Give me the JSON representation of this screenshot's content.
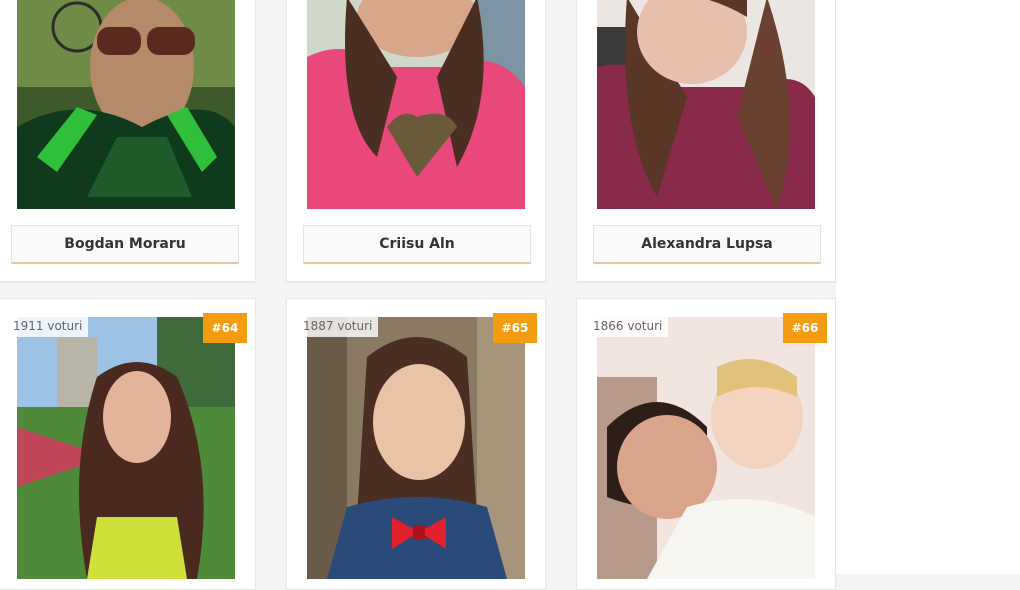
{
  "colors": {
    "accent": "#f39c12",
    "name_underline": "#e2c99a"
  },
  "row1": [
    {
      "name": "Bogdan Moraru"
    },
    {
      "name": "Criisu Aln"
    },
    {
      "name": "Alexandra Lupsa"
    }
  ],
  "row2": [
    {
      "votes": "1911 voturi",
      "rank": "#64"
    },
    {
      "votes": "1887 voturi",
      "rank": "#65"
    },
    {
      "votes": "1866 voturi",
      "rank": "#66"
    }
  ]
}
